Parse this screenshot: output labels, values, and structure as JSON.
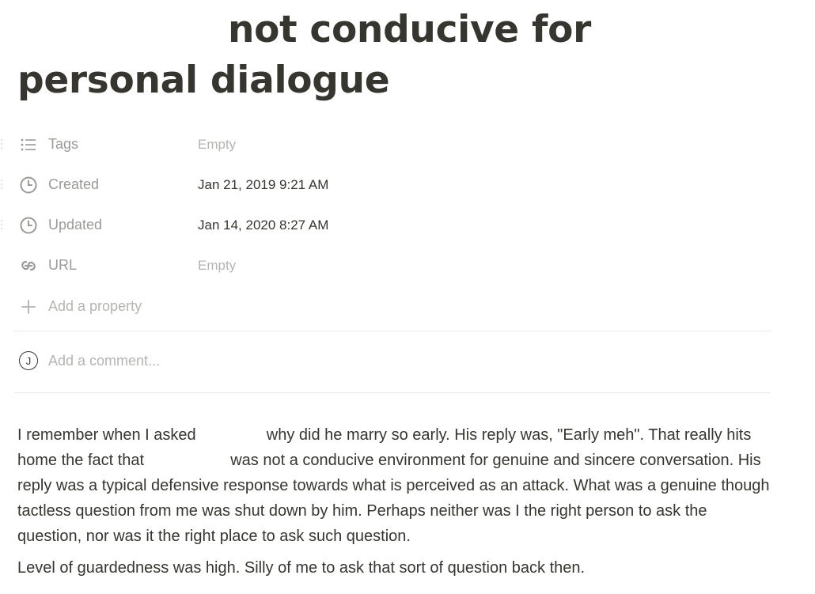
{
  "page": {
    "title": "not conducive for personal dialogue"
  },
  "properties": [
    {
      "name": "Tags",
      "value": "Empty",
      "icon": "list-icon",
      "empty": true
    },
    {
      "name": "Created",
      "value": "Jan 21, 2019 9:21 AM",
      "icon": "clock-icon",
      "empty": false
    },
    {
      "name": "Updated",
      "value": "Jan 14, 2020 8:27 AM",
      "icon": "clock-icon",
      "empty": false
    },
    {
      "name": "URL",
      "value": "Empty",
      "icon": "link-icon",
      "empty": true
    }
  ],
  "add_property": {
    "label": "Add a property",
    "icon": "plus-icon"
  },
  "comment": {
    "avatar_initial": "J",
    "placeholder": "Add a comment..."
  },
  "body": {
    "p1_a": "I remember when I asked",
    "p1_b": "why did he marry so early. His reply was, \"Early meh\". That really hits home the fact that",
    "p1_c": "was not a conducive environment for genuine and sincere conversation. His reply was a typical defensive response towards what is perceived as an attack. What was a genuine though tactless question from me was shut down by him. Perhaps neither was I the right person to ask the question, nor was it the right place to ask such question.",
    "p2": "Level of guardedness was high. Silly of me to ask that sort of question back then."
  },
  "colors": {
    "text": "#37352f",
    "muted": "#9b9a97",
    "placeholder": "#b5b4b1",
    "divider": "#e9e9e7"
  }
}
